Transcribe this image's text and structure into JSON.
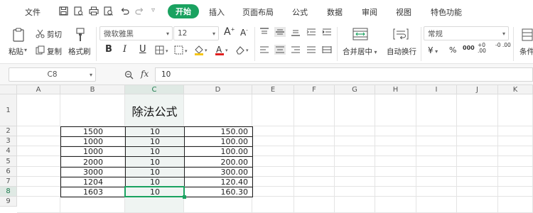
{
  "menu": {
    "file": "文件",
    "tabs": [
      "开始",
      "插入",
      "页面布局",
      "公式",
      "数据",
      "审阅",
      "视图",
      "特色功能"
    ],
    "active_tab": "开始",
    "dropdown_symbol": "▿"
  },
  "ribbon": {
    "paste": "粘贴",
    "cut": "剪切",
    "copy": "复制",
    "format_painter": "格式刷",
    "font_name": "微软雅黑",
    "font_size": "12",
    "increase_font": "A",
    "decrease_font": "A",
    "bold": "B",
    "italic": "I",
    "underline": "U",
    "merge_center": "合并居中",
    "wrap_text": "自动换行",
    "number_format": "常规",
    "currency": "¥",
    "percent": "%",
    "thousands": "000",
    "inc_decimal": "+0 .00",
    "dec_decimal": "-0 .00",
    "conditional": "条件"
  },
  "formula_bar": {
    "name_box": "C8",
    "fx": "fx",
    "value": "10"
  },
  "sheet": {
    "columns": [
      "A",
      "B",
      "C",
      "D",
      "E",
      "F",
      "G",
      "H",
      "I",
      "J",
      "K"
    ],
    "rows": [
      "1",
      "2",
      "3",
      "4",
      "5",
      "6",
      "7",
      "8",
      "9"
    ],
    "selected_column": "C",
    "selected_row": "8",
    "title": "除法公式",
    "data": [
      [
        "1500",
        "10",
        "150.00"
      ],
      [
        "1000",
        "10",
        "100.00"
      ],
      [
        "1000",
        "10",
        "100.00"
      ],
      [
        "2000",
        "10",
        "200.00"
      ],
      [
        "3000",
        "10",
        "300.00"
      ],
      [
        "1204",
        "10",
        "120.40"
      ],
      [
        "1603",
        "10",
        "160.30"
      ]
    ],
    "colors": {
      "accent": "#1aa260",
      "header_bg": "#f3f3f3",
      "selected_header_bg": "#dfe9e4",
      "selected_col_bg": "#eff4f2"
    }
  }
}
